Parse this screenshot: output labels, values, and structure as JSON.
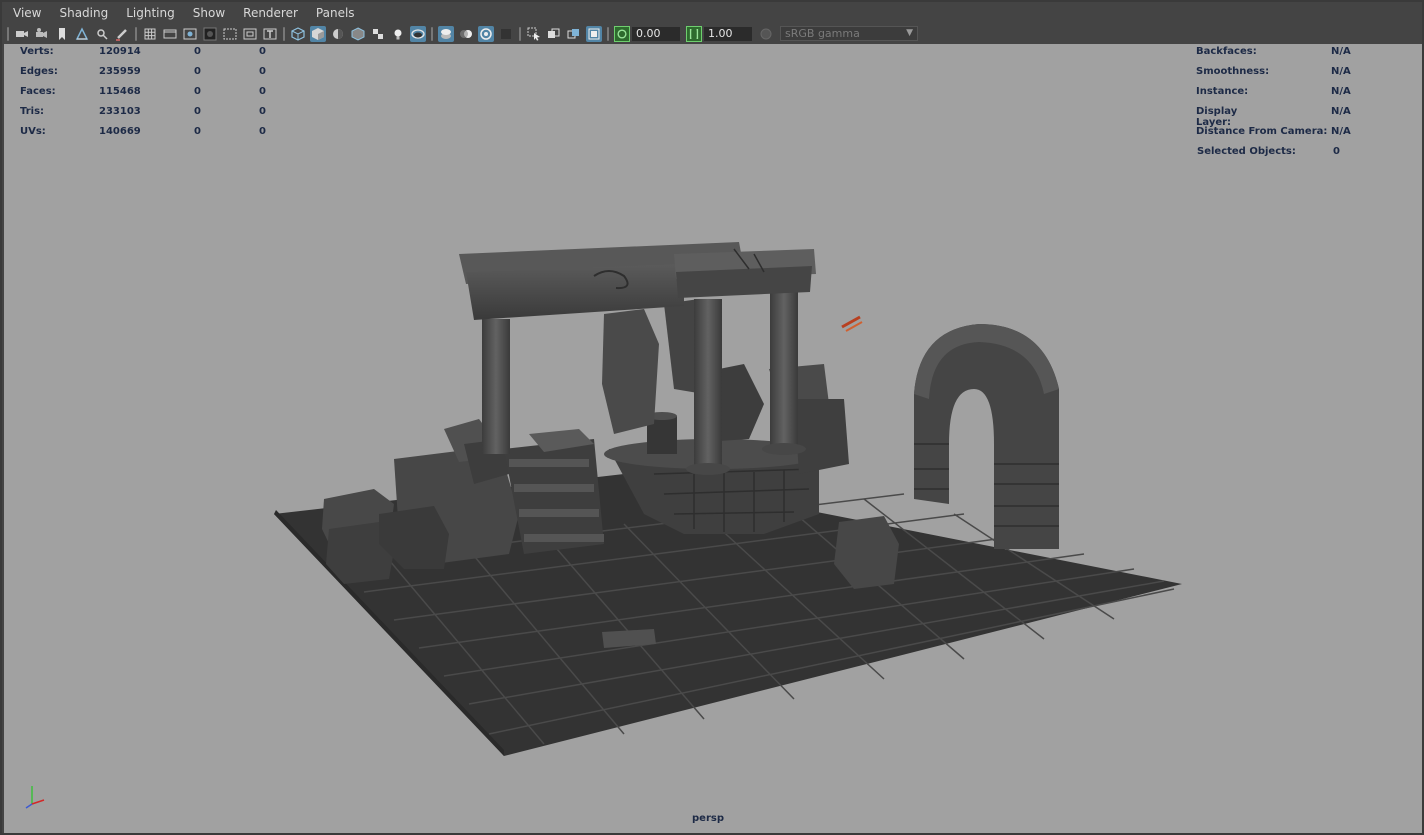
{
  "menu": [
    "View",
    "Shading",
    "Lighting",
    "Show",
    "Renderer",
    "Panels"
  ],
  "toolbar": {
    "icons": [
      "camera-select-icon",
      "camera-attributes-icon",
      "bookmark-icon",
      "image-plane-icon",
      "2d-pan-zoom-icon",
      "grease-pencil-icon",
      "grid-icon",
      "film-gate-icon",
      "resolution-gate-icon",
      "gate-mask-icon",
      "field-chart-icon",
      "safe-action-icon",
      "safe-title-icon",
      "wireframe-icon",
      "smooth-shade-icon",
      "use-default-material-icon",
      "wireframe-on-shaded-icon",
      "textured-icon",
      "use-all-lights-icon",
      "shadows-icon",
      "screen-space-ao-icon",
      "motion-blur-icon",
      "multisample-aa-icon",
      "depth-of-field-icon",
      "isolate-select-icon",
      "xray-icon",
      "xray-active-components-icon",
      "xray-joints-icon"
    ],
    "exposure_value": "0.00",
    "gamma_value": "1.00",
    "color_space": "sRGB gamma"
  },
  "hud_left": {
    "rows": [
      {
        "label": "Verts:",
        "a": "120914",
        "b": "0",
        "c": "0"
      },
      {
        "label": "Edges:",
        "a": "235959",
        "b": "0",
        "c": "0"
      },
      {
        "label": "Faces:",
        "a": "115468",
        "b": "0",
        "c": "0"
      },
      {
        "label": "Tris:",
        "a": "233103",
        "b": "0",
        "c": "0"
      },
      {
        "label": "UVs:",
        "a": "140669",
        "b": "0",
        "c": "0"
      }
    ]
  },
  "hud_right": {
    "rows": [
      {
        "label": "Backfaces:",
        "value": "N/A"
      },
      {
        "label": "Smoothness:",
        "value": "N/A"
      },
      {
        "label": "Instance:",
        "value": "N/A"
      },
      {
        "label": "Display Layer:",
        "value": "N/A"
      },
      {
        "label": "Distance From Camera:",
        "value": "N/A"
      },
      {
        "label": "Selected Objects:",
        "value": "0"
      }
    ]
  },
  "camera_label": "persp",
  "colors": {
    "viewport_bg": "#a1a1a1",
    "hud_text": "#1d2a46",
    "ui_bg": "#444444",
    "active_button": "#5285a6",
    "axis_x": "#d22828",
    "axis_y": "#3cbf3c",
    "axis_z": "#3c5ad2"
  }
}
